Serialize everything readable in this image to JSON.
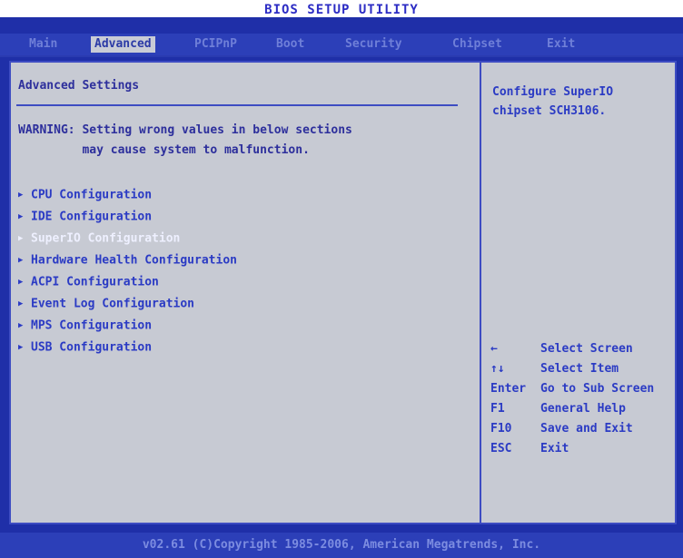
{
  "app": {
    "title": "BIOS SETUP UTILITY"
  },
  "tabs": [
    {
      "label": "Main"
    },
    {
      "label": "Advanced"
    },
    {
      "label": "PCIPnP"
    },
    {
      "label": "Boot"
    },
    {
      "label": "Security"
    },
    {
      "label": "Chipset"
    },
    {
      "label": "Exit"
    }
  ],
  "main": {
    "heading": "Advanced Settings",
    "warning_line1": "WARNING: Setting wrong values in below sections",
    "warning_line2": "         may cause system to malfunction.",
    "menu": [
      {
        "label": "CPU Configuration"
      },
      {
        "label": "IDE Configuration"
      },
      {
        "label": "SuperIO Configuration"
      },
      {
        "label": "Hardware Health Configuration"
      },
      {
        "label": "ACPI Configuration"
      },
      {
        "label": "Event Log Configuration"
      },
      {
        "label": "MPS Configuration"
      },
      {
        "label": "USB Configuration"
      }
    ]
  },
  "help": {
    "text": "Configure SuperIO chipset SCH3106."
  },
  "keys": [
    {
      "key": "←",
      "desc": "Select Screen"
    },
    {
      "key": "↑↓",
      "desc": "Select Item"
    },
    {
      "key": "Enter",
      "desc": "Go to Sub Screen"
    },
    {
      "key": "F1",
      "desc": "General Help"
    },
    {
      "key": "F10",
      "desc": "Save and Exit"
    },
    {
      "key": "ESC",
      "desc": "Exit"
    }
  ],
  "footer": {
    "text": "v02.61 (C)Copyright 1985-2006, American Megatrends, Inc."
  },
  "colors": {
    "background": "#1f2fa8",
    "panel": "#c7cad3",
    "text": "#2b3bc4",
    "selected": "#eef0ff"
  }
}
